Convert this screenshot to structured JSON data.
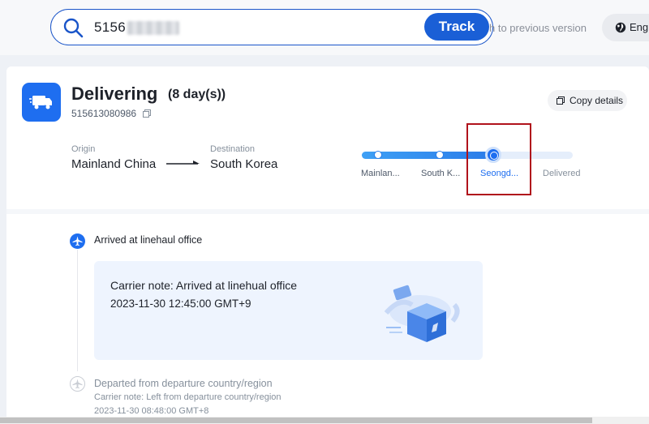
{
  "search": {
    "value": "5156",
    "button": "Track"
  },
  "header": {
    "prev_version": "h to previous version",
    "language": "Engl"
  },
  "status": {
    "title": "Delivering",
    "days": "(8 day(s))",
    "tracking_number": "515613080986"
  },
  "copy_details": "Copy details",
  "route": {
    "origin_label": "Origin",
    "origin": "Mainland China",
    "destination_label": "Destination",
    "destination": "South Korea"
  },
  "progress": {
    "fraction": 0.6,
    "steps": [
      {
        "label": "Mainlan...",
        "state": "done"
      },
      {
        "label": "South K...",
        "state": "done"
      },
      {
        "label": "Seongd...",
        "state": "current"
      },
      {
        "label": "Delivered",
        "state": "pending"
      }
    ]
  },
  "events": [
    {
      "title": "Arrived at linehaul office",
      "note": "Carrier note: Arrived at linehual office",
      "time": "2023-11-30 12:45:00 GMT+9"
    },
    {
      "title": "Departed from departure country/region",
      "note": "Carrier note: Left from departure country/region",
      "time": "2023-11-30 08:48:00 GMT+8"
    }
  ],
  "colors": {
    "accent": "#1e6ef0",
    "highlight": "#b0121b"
  }
}
